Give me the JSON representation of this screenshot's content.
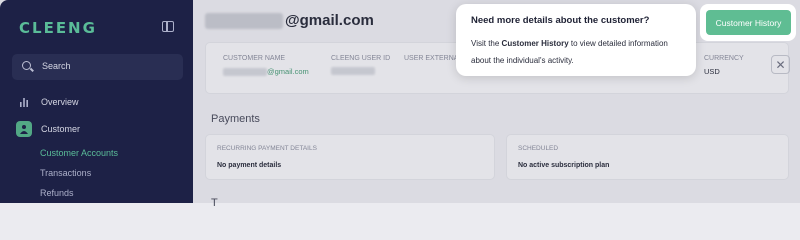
{
  "sidebar": {
    "logo": "CLEENG",
    "search_label": "Search",
    "items": [
      {
        "label": "Overview"
      },
      {
        "label": "Customer"
      }
    ],
    "sub_items": [
      {
        "label": "Customer Accounts"
      },
      {
        "label": "Transactions"
      },
      {
        "label": "Refunds"
      }
    ]
  },
  "header": {
    "email_suffix": "@gmail.com"
  },
  "info": {
    "customer_name_label": "CUSTOMER NAME",
    "customer_name_value": "@gmail.com",
    "user_id_label": "CLEENG USER ID",
    "external_label": "USER EXTERNA",
    "currency_label": "CURRENCY",
    "currency_value": "USD"
  },
  "payments": {
    "title": "Payments",
    "recurring_label": "RECURRING PAYMENT DETAILS",
    "recurring_value": "No payment details",
    "scheduled_label": "SCHEDULED",
    "scheduled_value": "No active subscription plan"
  },
  "next_section": {
    "title": "T"
  },
  "tooltip": {
    "title": "Need more details about the customer?",
    "body_prefix": "Visit the ",
    "body_bold": "Customer History",
    "body_suffix": " to view detailed information about the individual's activity."
  },
  "actions": {
    "customer_history_label": "Customer History"
  },
  "colors": {
    "sidebar_bg": "#1d2147",
    "accent": "#5fbd93"
  }
}
